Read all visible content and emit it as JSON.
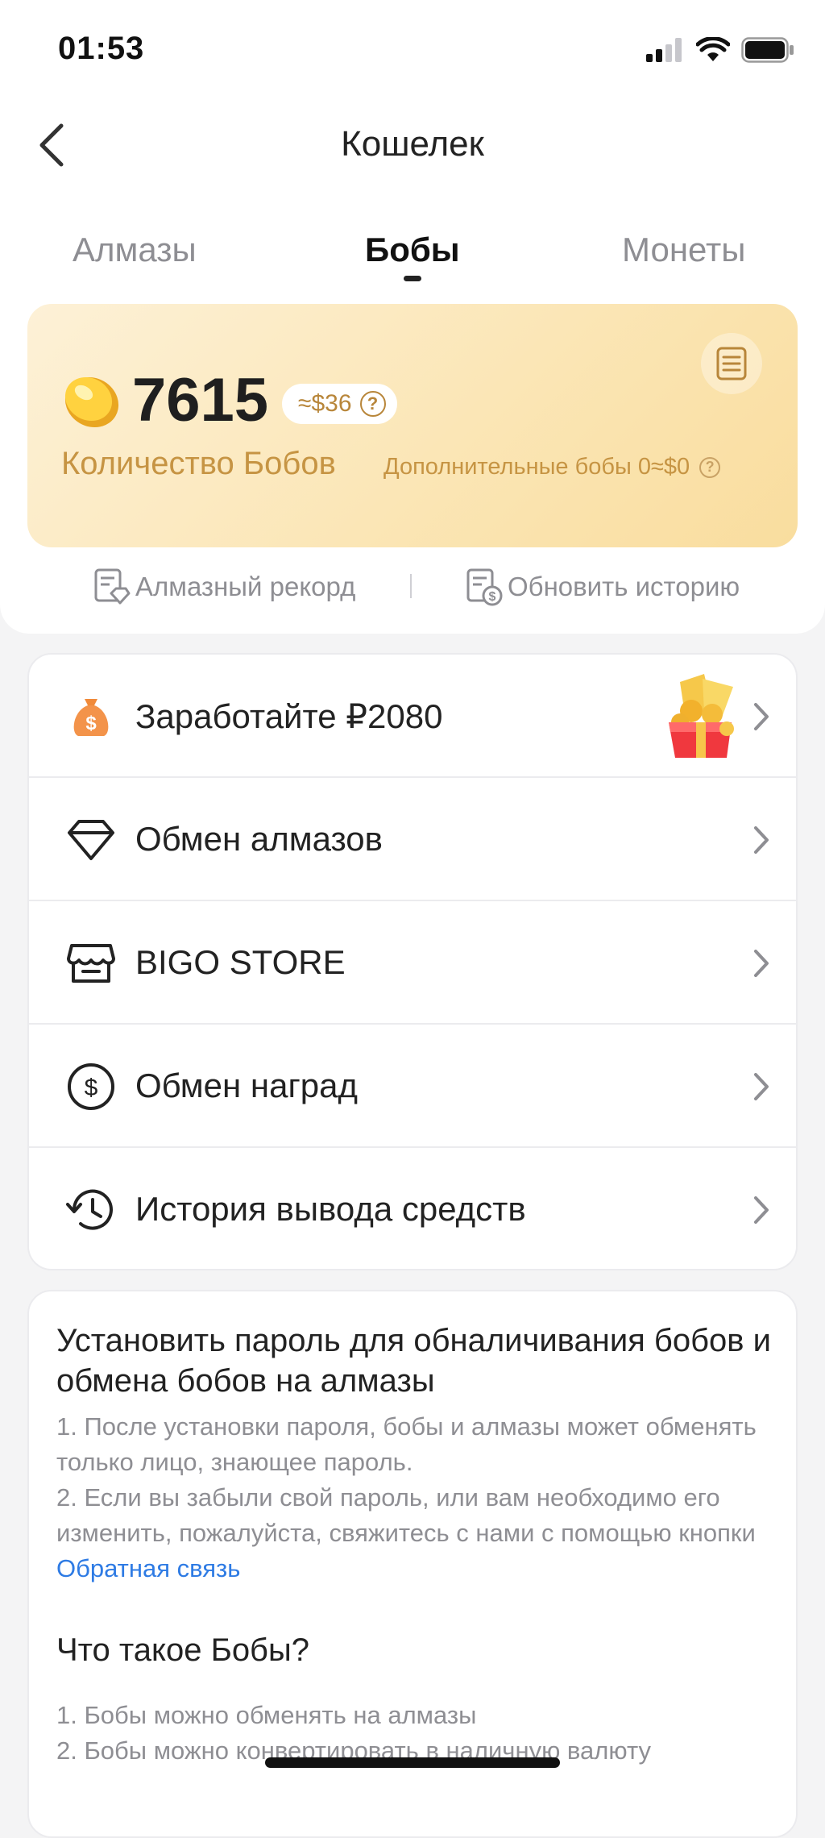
{
  "status_bar": {
    "time": "01:53"
  },
  "header": {
    "title": "Кошелек"
  },
  "tabs": [
    {
      "label": "Алмазы",
      "active": false
    },
    {
      "label": "Бобы",
      "active": true
    },
    {
      "label": "Монеты",
      "active": false
    }
  ],
  "balance": {
    "amount": "7615",
    "usd_equiv": "≈$36",
    "label": "Количество Бобов",
    "extra": "Дополнительные бобы 0≈$0"
  },
  "records": {
    "diamond_record": "Алмазный рекорд",
    "update_history": "Обновить историю"
  },
  "menu": [
    {
      "label": "Заработайте ₽2080",
      "icon": "money-bag-icon"
    },
    {
      "label": "Обмен алмазов",
      "icon": "diamond-icon"
    },
    {
      "label": "BIGO STORE",
      "icon": "store-icon"
    },
    {
      "label": "Обмен наград",
      "icon": "dollar-circle-icon"
    },
    {
      "label": "История вывода средств",
      "icon": "history-icon"
    }
  ],
  "info": {
    "password_title": "Установить пароль для обналичивания бобов и обмена бобов на алмазы",
    "password_p1": "1. После установки пароля, бобы и алмазы может обменять только лицо, знающее пароль.",
    "password_p2": "2. Если вы забыли свой пароль, или вам необходимо его изменить, пожалуйста, свяжитесь с нами с помощью кнопки",
    "feedback_link": "Обратная связь",
    "beans_title": "Что такое Бобы?",
    "beans_p1": "1. Бобы можно обменять на алмазы",
    "beans_p2": "2. Бобы можно конвертировать в наличную валюту"
  },
  "colors": {
    "accent_gold": "#c69443",
    "link_blue": "#2e7be4",
    "card_gradient_start": "#fdf1d7",
    "card_gradient_end": "#f9dd9e"
  }
}
